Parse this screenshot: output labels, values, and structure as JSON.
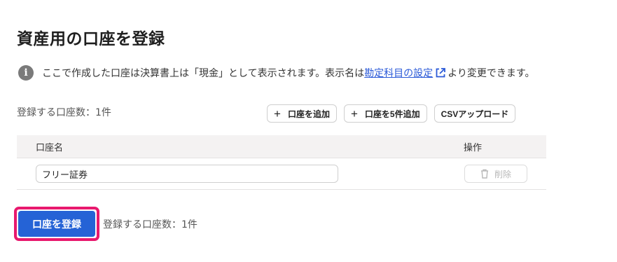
{
  "page": {
    "title": "資産用の口座を登録"
  },
  "info": {
    "icon": "info-icon",
    "text_before": "ここで作成した口座は決算書上は「現金」として表示されます。表示名は",
    "link_text": "勘定科目の設定",
    "link_icon": "external-link-icon",
    "text_after": "より変更できます。"
  },
  "list": {
    "count_label": "登録する口座数：1件"
  },
  "toolbar": {
    "add_label": "口座を追加",
    "add_five_label": "口座を5件追加",
    "csv_label": "CSVアップロード"
  },
  "table": {
    "headers": {
      "name": "口座名",
      "operation": "操作"
    },
    "rows": [
      {
        "account_name": "フリー証券",
        "delete_label": "削除"
      }
    ]
  },
  "footer": {
    "register_label": "口座を登録",
    "count_label": "登録する口座数：1件"
  },
  "colors": {
    "primary": "#2563d6",
    "highlight": "#e8196e",
    "link": "#2b5ad8"
  }
}
